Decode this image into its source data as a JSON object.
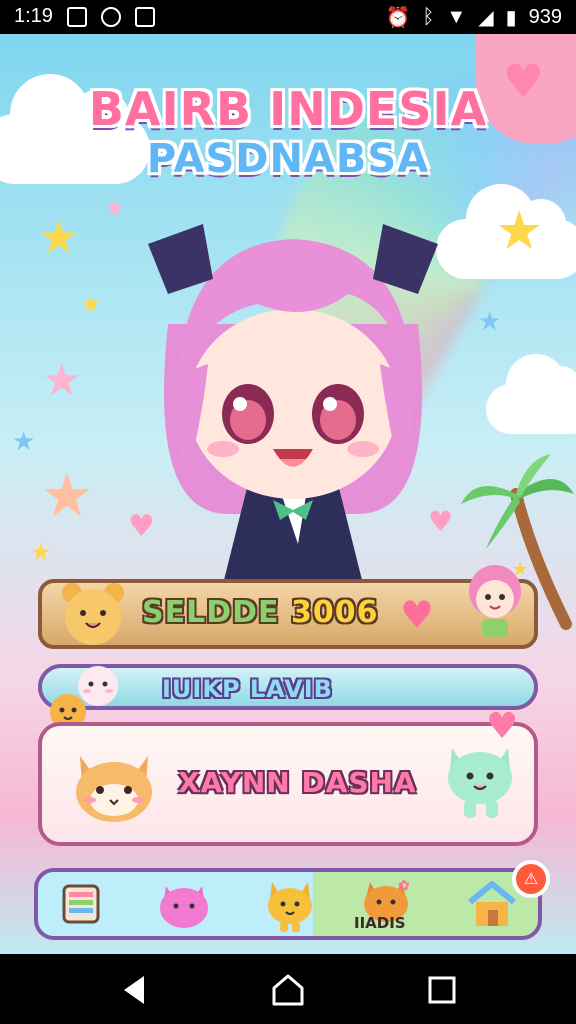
{
  "status_bar": {
    "time": "1:19",
    "battery": "939"
  },
  "game": {
    "title_line1": "BAIRB INDESIA",
    "title_line2": "PASDNABSA",
    "score_panel": {
      "label": "SELDDE",
      "value": "3006"
    },
    "level_bar": {
      "label": "IUIKP LAVIB"
    },
    "name_panel": {
      "name": "XAYNN DASHA"
    },
    "bottom_nav": {
      "items": [
        "book-icon",
        "pink-pet-icon",
        "cat-pet-icon",
        "orange-pet-icon",
        "home-icon"
      ],
      "active_label": "IIADIS"
    }
  },
  "colors": {
    "pink": "#ff6fa0",
    "yellow": "#ffd23a",
    "blue": "#5fb8f5",
    "green": "#8be07a",
    "purple": "#8059a6"
  }
}
